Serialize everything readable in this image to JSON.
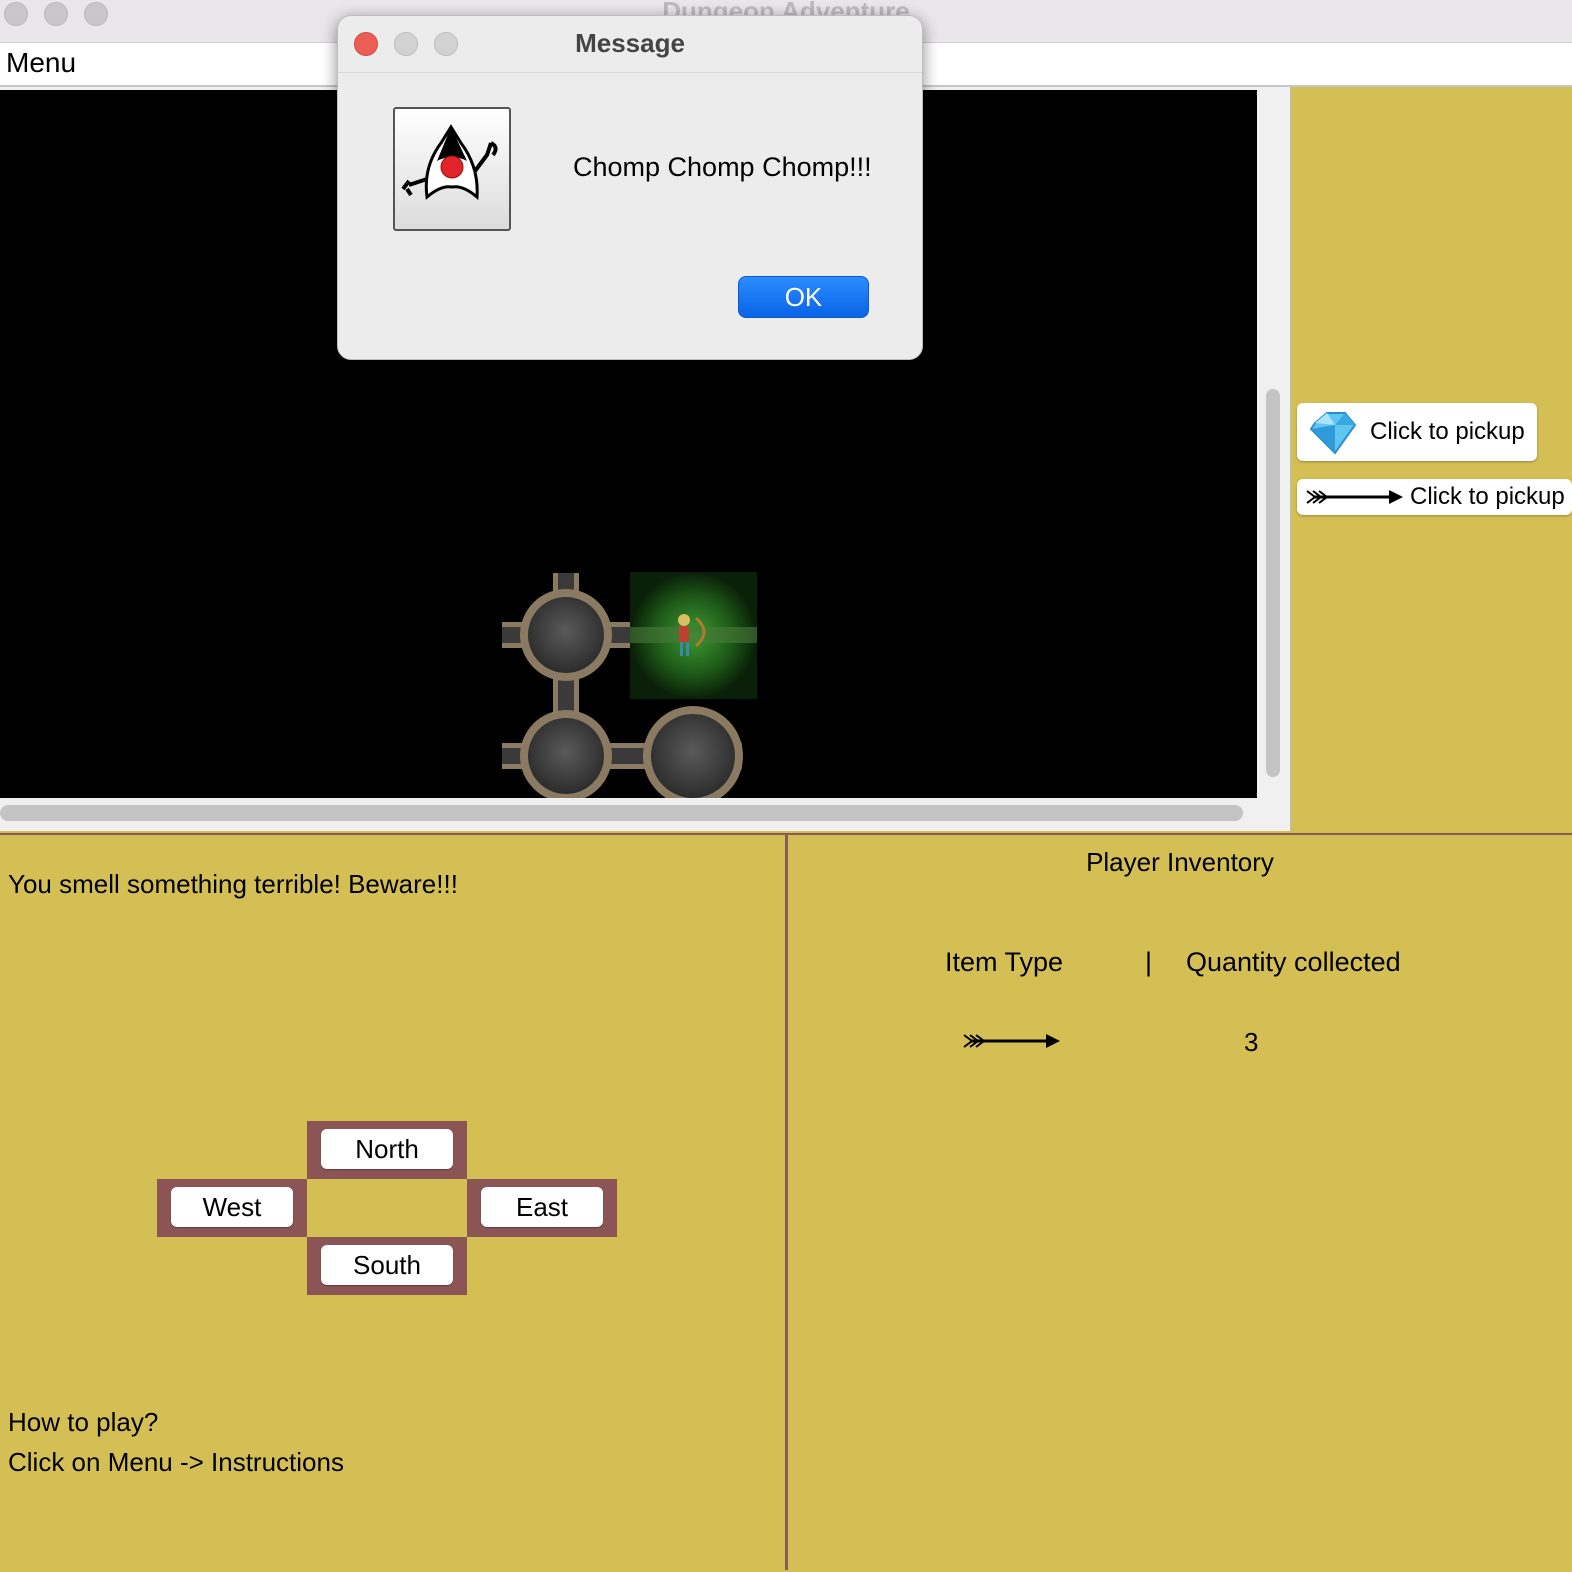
{
  "window": {
    "title": "Dungeon Adventure"
  },
  "menubar": {
    "menu_label": "Menu"
  },
  "dialog": {
    "title": "Message",
    "message": "Chomp Chomp Chomp!!!",
    "ok_label": "OK",
    "icon": "java-duke-icon"
  },
  "pickups": [
    {
      "icon": "diamond-icon",
      "label": "Click to pickup"
    },
    {
      "icon": "arrow-icon",
      "label": "Click to pickup"
    }
  ],
  "status": {
    "message": "You smell something terrible! Beware!!!",
    "help_line1": "How to play?",
    "help_line2": "Click on Menu -> Instructions"
  },
  "directions": {
    "north": "North",
    "west": "West",
    "east": "East",
    "south": "South"
  },
  "inventory": {
    "title": "Player Inventory",
    "col_item": "Item Type",
    "separator": "|",
    "col_qty": "Quantity collected",
    "rows": [
      {
        "icon": "arrow-icon",
        "quantity": "3"
      }
    ]
  },
  "colors": {
    "panel_background": "#d4bf55",
    "direction_frame": "#8b5555",
    "map_background": "#000000",
    "ok_button": "#0a64e6"
  }
}
